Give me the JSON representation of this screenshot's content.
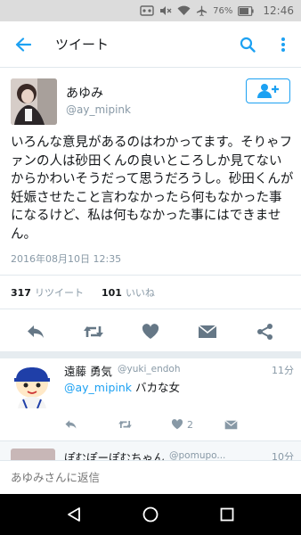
{
  "status_bar": {
    "battery_percent": "76%",
    "time": "12:46"
  },
  "appbar": {
    "title": "ツイート",
    "icons": [
      "back-arrow-icon",
      "search-icon",
      "more-vertical-icon"
    ]
  },
  "tweet": {
    "author_name": "あゆみ",
    "author_handle": "@ay_mipink",
    "text": "いろんな意見があるのはわかってます。そりゃファンの人は砂田くんの良いところしか見てないからかわいそうだって思うだろうし。砂田くんが妊娠させたこと言わなかったら何もなかった事になるけど、私は何もなかった事にはできません。",
    "date": "2016年08月10日 12:35",
    "retweet_count": "317",
    "retweet_label": "リツイート",
    "like_count": "101",
    "like_label": "いいね"
  },
  "reply": {
    "name": "遠藤 勇気",
    "handle": "@yuki_endoh",
    "time": "11分",
    "mention": "@ay_mipink",
    "text": " バカな女",
    "like_count": "2"
  },
  "reply2": {
    "name": "ぽむぽーぽむちゃん",
    "handle": "@pomupo...",
    "time": "10分"
  },
  "compose": {
    "placeholder": "あゆみさんに返信"
  },
  "colors": {
    "accent": "#1da1f2",
    "muted": "#8899a6",
    "icon_gray": "#657786"
  }
}
